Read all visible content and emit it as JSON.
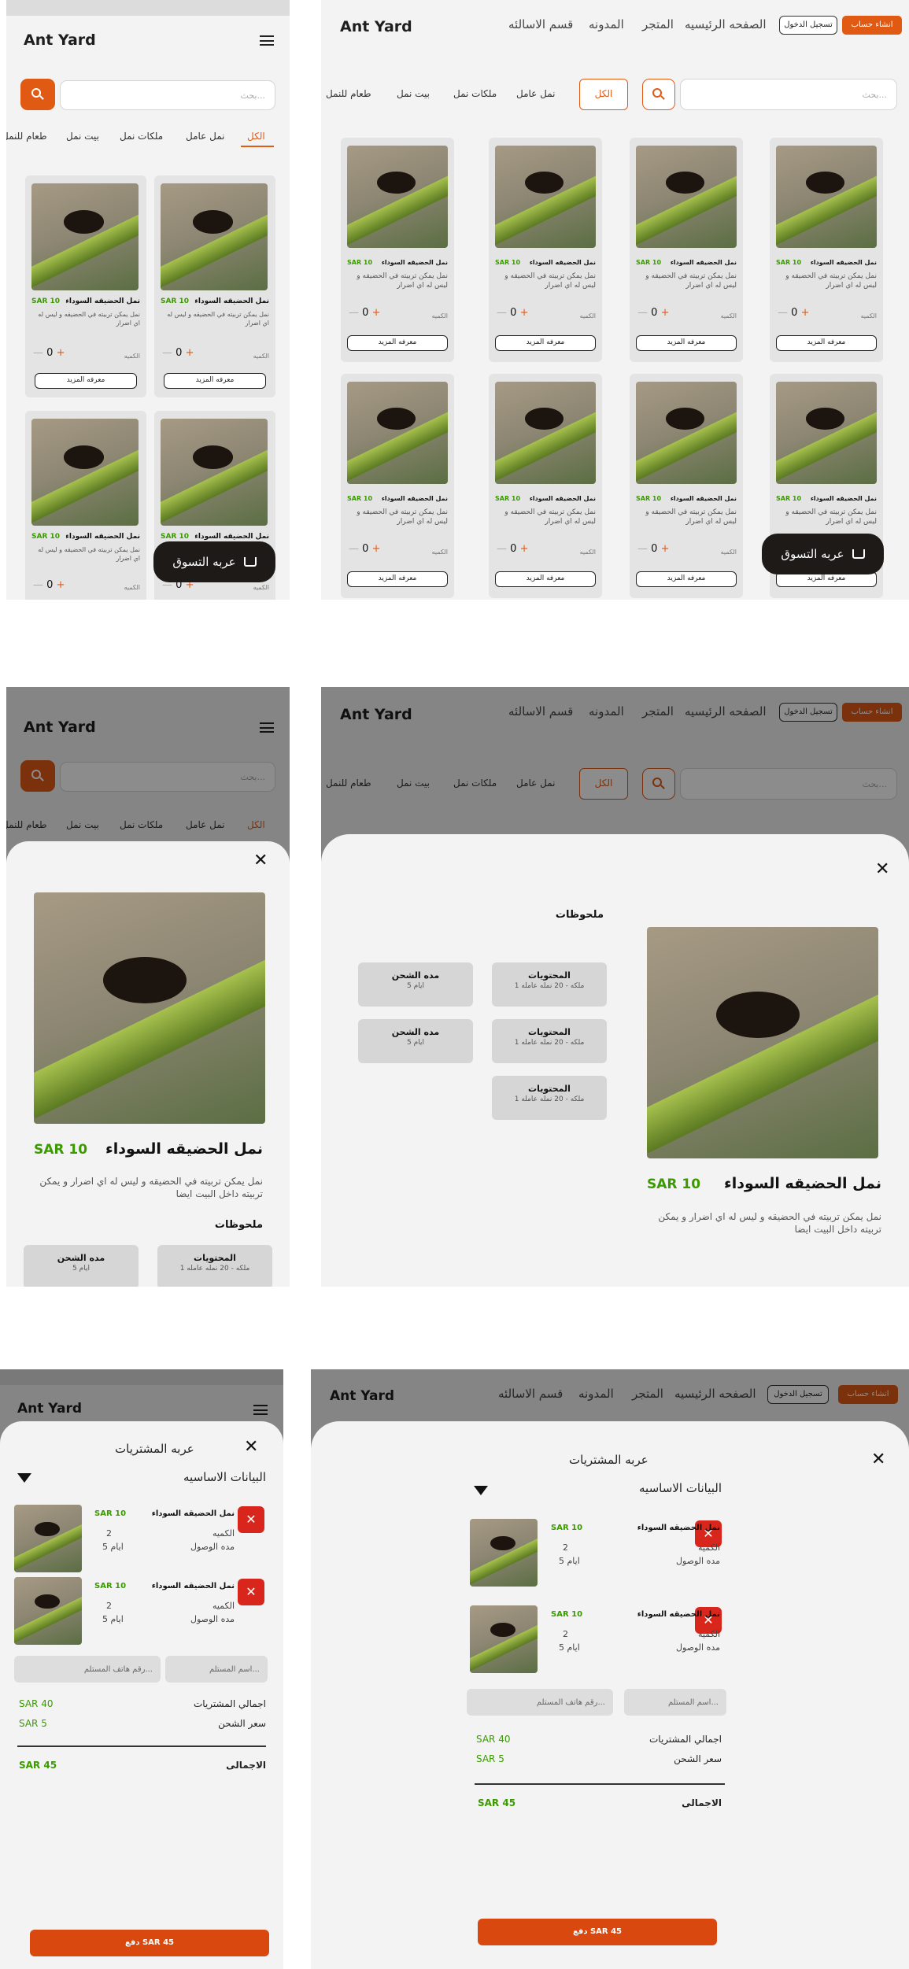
{
  "brand": {
    "logo": "Ant Yard",
    "accent": "#e05a14",
    "price_color": "#3a9a00"
  },
  "header": {
    "create_account": "انشاء حساب",
    "login": "تسجيل الدخول",
    "nav": [
      "الصفحه الرئيسيه",
      "المتجر",
      "المدونه",
      "قسم الاسالئه"
    ]
  },
  "search": {
    "placeholder": "بحث..."
  },
  "categories": {
    "desktop": [
      "الكل",
      "نمل عامل",
      "ملكات نمل",
      "بيت نمل",
      "طعام للنمل"
    ],
    "mobile": [
      "الكل",
      "نمل عامل",
      "ملكات نمل",
      "بيت نمل",
      "طعام للنمل"
    ],
    "active": "الكل"
  },
  "product": {
    "name": "نمل الحضيقه السوداء",
    "price": "SAR 10",
    "short_desc": "نمل يمكن تربيته في الحضيقه و ليس له اي اضرار",
    "full_desc": "نمل يمكن تربيته في الحضيقه و ليس له اي اضرار و يمكن تربيته داخل البيت ايضا",
    "qty_label": "الكميه",
    "qty_value": "0",
    "minus": "—",
    "plus": "+",
    "more": "معرفه المزيد"
  },
  "cart_button": "عربه التسوق",
  "detail": {
    "notes_title": "ملحوظات",
    "contents_title": "المحتويات",
    "contents_value": "1 ملكه - 20 نمله عامله",
    "shipping_title": "مده الشحن",
    "shipping_value": "5 ايام",
    "close": "✕"
  },
  "cart": {
    "title": "عربه المشتريات",
    "section": "البيانات الاساسيه",
    "items": [
      {
        "name": "نمل الحضيقه السوداء",
        "price": "SAR 10",
        "qty_label": "الكميه",
        "qty": "2",
        "arrival_label": "مده الوصول",
        "arrival": "5 ايام"
      },
      {
        "name": "نمل الحضيقه السوداء",
        "price": "SAR 10",
        "qty_label": "الكميه",
        "qty": "2",
        "arrival_label": "مده الوصول",
        "arrival": "5 ايام"
      }
    ],
    "name_placeholder": "اسم المستلم...",
    "phone_placeholder": "رقم هاتف المستلم...",
    "subtotal_label": "اجمالي المشتريات",
    "subtotal": "SAR 40",
    "shipping_label": "سعر الشحن",
    "shipping": "SAR 5",
    "total_label": "الاجمالى",
    "total": "SAR 45",
    "pay": "دفع SAR 45"
  }
}
